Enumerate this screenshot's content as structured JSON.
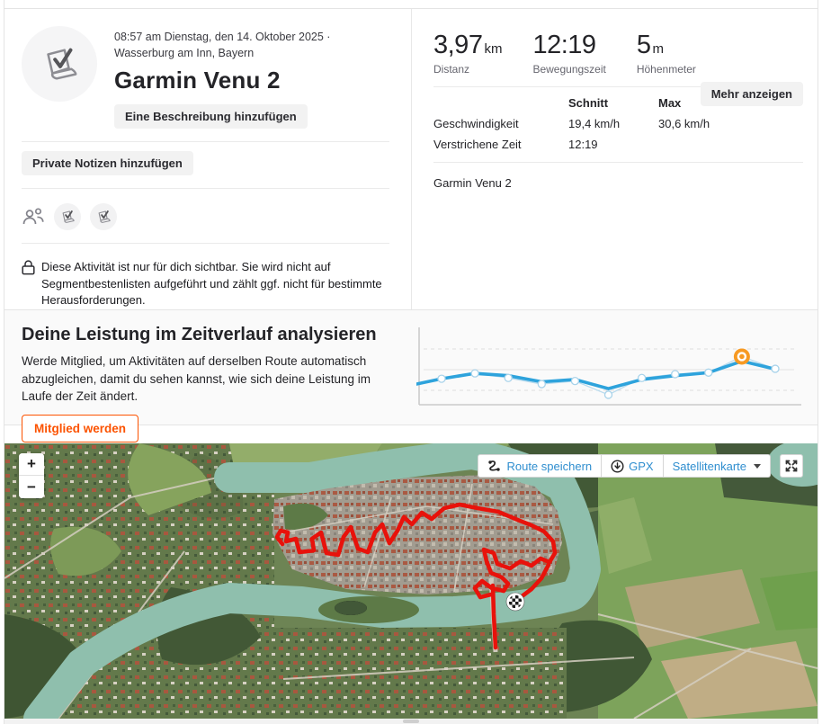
{
  "header": {
    "datetime_location": "08:57 am Dienstag, den 14. Oktober 2025 · Wasserburg am Inn, Bayern",
    "title": "Garmin Venu 2",
    "add_description_label": "Eine Beschreibung hinzufügen",
    "private_notes_label": "Private Notizen hinzufügen",
    "privacy_notice": "Diese Aktivität ist nur für dich sichtbar. Sie wird nicht auf Segmentbestenlisten aufgeführt und zählt ggf. nicht für bestimmte Herausforderungen.",
    "icons": [
      "group-icon",
      "device-badge-icon",
      "device-badge-icon"
    ]
  },
  "stats": {
    "primary": [
      {
        "value": "3,97",
        "unit": "km",
        "label": "Distanz"
      },
      {
        "value": "12:19",
        "unit": "",
        "label": "Bewegungszeit"
      },
      {
        "value": "5",
        "unit": "m",
        "label": "Höhenmeter"
      }
    ],
    "table": {
      "col_avg": "Schnitt",
      "col_max": "Max",
      "rows": [
        {
          "label": "Geschwindigkeit",
          "avg": "19,4 km/h",
          "max": "30,6 km/h"
        },
        {
          "label": "Verstrichene Zeit",
          "avg": "12:19",
          "max": ""
        }
      ],
      "more_label": "Mehr anzeigen"
    },
    "device": "Garmin Venu 2"
  },
  "promo": {
    "title": "Deine Leistung im Zeitverlauf analysieren",
    "body": "Werde Mitglied, um Aktivitäten auf derselben Route automatisch abzugleichen, damit du sehen kannst, wie sich deine Leistung im Laufe der Zeit ändert.",
    "cta_label": "Mitglied werden"
  },
  "chart_data": {
    "type": "line",
    "title": "",
    "xlabel": "",
    "ylabel": "",
    "ylim": [
      0,
      100
    ],
    "grid": "dashed horizontal",
    "legend": "none",
    "series": [
      {
        "name": "activity-points",
        "x": [
          1,
          2,
          3,
          4,
          5,
          6,
          7,
          8,
          9,
          10,
          11
        ],
        "values": [
          34,
          41,
          35,
          27,
          31,
          13,
          35,
          40,
          42,
          63,
          47
        ]
      },
      {
        "name": "trend",
        "x": [
          0.25,
          1,
          2,
          3,
          4,
          5,
          6,
          7,
          8,
          9,
          10,
          10.95
        ],
        "values": [
          27,
          34,
          41,
          38,
          30,
          33,
          21,
          33,
          38,
          42,
          57,
          47
        ]
      }
    ],
    "highlight": {
      "series": "activity-points",
      "index": 9,
      "color": "#f79a23"
    }
  },
  "map": {
    "controls": {
      "zoom_in": "+",
      "zoom_out": "−",
      "save_route": "Route speichern",
      "gpx": "GPX",
      "layer": "Satellitenkarte"
    },
    "route_color": "#e8120b",
    "water_color": "#8fbfad",
    "route": {
      "main": [
        [
          309,
          112
        ],
        [
          303,
          104
        ],
        [
          307,
          97
        ],
        [
          315,
          99
        ],
        [
          313,
          109
        ],
        [
          324,
          106
        ],
        [
          328,
          121
        ],
        [
          344,
          119
        ],
        [
          342,
          106
        ],
        [
          352,
          99
        ],
        [
          358,
          122
        ],
        [
          371,
          124
        ],
        [
          377,
          104
        ],
        [
          385,
          93
        ],
        [
          393,
          117
        ],
        [
          404,
          121
        ],
        [
          412,
          99
        ],
        [
          420,
          90
        ],
        [
          428,
          111
        ],
        [
          437,
          97
        ],
        [
          444,
          82
        ],
        [
          453,
          90
        ],
        [
          464,
          77
        ],
        [
          475,
          84
        ],
        [
          489,
          72
        ],
        [
          506,
          68
        ],
        [
          526,
          72
        ],
        [
          549,
          76
        ],
        [
          561,
          81
        ],
        [
          573,
          86
        ],
        [
          586,
          91
        ],
        [
          600,
          98
        ],
        [
          610,
          109
        ],
        [
          612,
          122
        ],
        [
          606,
          132
        ],
        [
          596,
          128
        ],
        [
          586,
          136
        ],
        [
          574,
          131
        ],
        [
          562,
          139
        ],
        [
          548,
          134
        ],
        [
          544,
          122
        ],
        [
          533,
          118
        ],
        [
          536,
          131
        ],
        [
          541,
          144
        ],
        [
          553,
          149
        ],
        [
          560,
          156
        ],
        [
          555,
          164
        ],
        [
          542,
          161
        ],
        [
          531,
          153
        ],
        [
          523,
          161
        ],
        [
          529,
          171
        ],
        [
          541,
          168
        ]
      ],
      "bridge_spur": [
        [
          543,
          158
        ],
        [
          544,
          190
        ],
        [
          546,
          227
        ]
      ],
      "finish_approach": [
        [
          605,
          135
        ],
        [
          597,
          150
        ],
        [
          586,
          162
        ],
        [
          574,
          171
        ]
      ],
      "finish_point": [
        568,
        176
      ]
    }
  },
  "accent_colors": {
    "brand_orange": "#fc5200",
    "chart_blue": "#2ea3dc",
    "map_link_blue": "#2f8ecf"
  }
}
